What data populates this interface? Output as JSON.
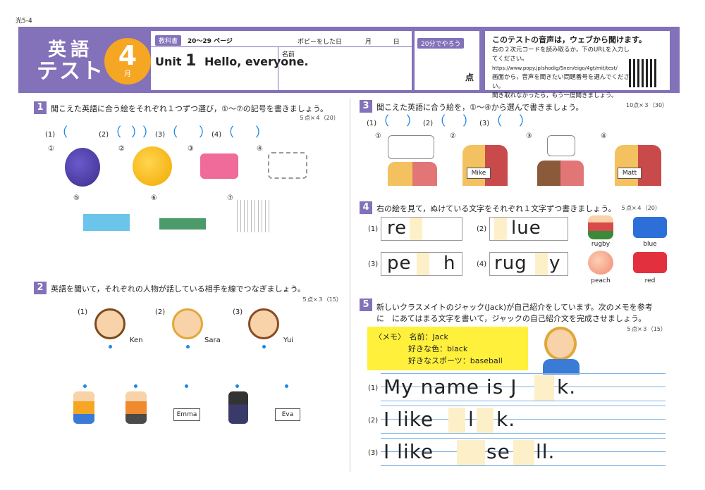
{
  "page_code": "光5-4",
  "header": {
    "eigo": "英語",
    "test": "テスト",
    "month": "4",
    "month_unit": "月",
    "textbook_tag": "教科書",
    "pages": "20〜29 ページ",
    "popy_day": "ポピーをした日",
    "m_label": "月",
    "d_label": "日",
    "unit_label": "Unit",
    "unit_num": "1",
    "unit_title": "Hello, everyone.",
    "name_label": "名前",
    "time_tag": "20分でやろう",
    "score_unit": "点"
  },
  "notice": {
    "title": "このテストの音声は，ウェブから聞けます。",
    "l1": "右の２次元コードを読み取るか，下のURLを入力してください。",
    "url": "https://www.popy.jp/shodig/5nen/eigo/4gt/mit/test/",
    "l2": "画面から，音声を聞きたい問題番号を選んでください。",
    "l3": "聞き取れなかったら，もう一度聞きましょう。"
  },
  "q1": {
    "num": "1",
    "text": "聞こえた英語に合う絵をそれぞれ１つずつ選び，①〜⑦の記号を書きましょう。",
    "points": "５点×４（20）",
    "answers": [
      "(1)",
      "(2)",
      "(3)",
      "(4)"
    ],
    "labels": [
      "①",
      "②",
      "③",
      "④",
      "⑤",
      "⑥",
      "⑦"
    ]
  },
  "q2": {
    "num": "2",
    "text": "英語を聞いて，それぞれの人物が話している相手を線でつなぎましょう。",
    "points": "５点×３（15）",
    "labels": [
      "(1)",
      "(2)",
      "(3)"
    ],
    "names": [
      "Ken",
      "Sara",
      "Yui"
    ],
    "signs": [
      "Emma",
      "Eva"
    ]
  },
  "q3": {
    "num": "3",
    "text": "聞こえた英語に合う絵を，①〜④から選んで書きましょう。",
    "points": "10点×３（30）",
    "answers": [
      "(1)",
      "(2)",
      "(3)"
    ],
    "labels": [
      "①",
      "②",
      "③",
      "④"
    ],
    "signs": [
      "Mike",
      "Matt"
    ]
  },
  "q4": {
    "num": "4",
    "text": "右の絵を見て，ぬけている文字をそれぞれ１文字ずつ書きましょう。",
    "points": "５点×４（20）",
    "items": [
      {
        "n": "(1)",
        "a": "re",
        "b": ""
      },
      {
        "n": "(2)",
        "a": "",
        "b": "lue"
      },
      {
        "n": "(3)",
        "a": "pe",
        "b": "h"
      },
      {
        "n": "(4)",
        "a": "rug",
        "b": "y"
      }
    ],
    "pics": [
      "rugby",
      "blue",
      "peach",
      "red"
    ]
  },
  "q5": {
    "num": "5",
    "text1": "新しいクラスメイトのジャック(Jack)が自己紹介をしています。次のメモを参考",
    "text2": "に　にあてはまる文字を書いて，ジャックの自己紹介文を完成させましょう。",
    "points": "５点×３（15）",
    "memo_title": "〈メモ〉",
    "memo1": "名前：Jack",
    "memo2": "好きな色：black",
    "memo3": "好きなスポーツ：baseball",
    "lines": [
      {
        "n": "(1)",
        "a": "My name is J",
        "b": "k."
      },
      {
        "n": "(2)",
        "a": "I like ",
        "m": "l",
        "b": "k."
      },
      {
        "n": "(3)",
        "a": "I like ",
        "m": "se",
        "b": "ll."
      }
    ]
  },
  "colors": {
    "header": "#8371b9",
    "accent": "#f5a623",
    "blue": "#1e88e5",
    "memo": "#fff13b"
  }
}
